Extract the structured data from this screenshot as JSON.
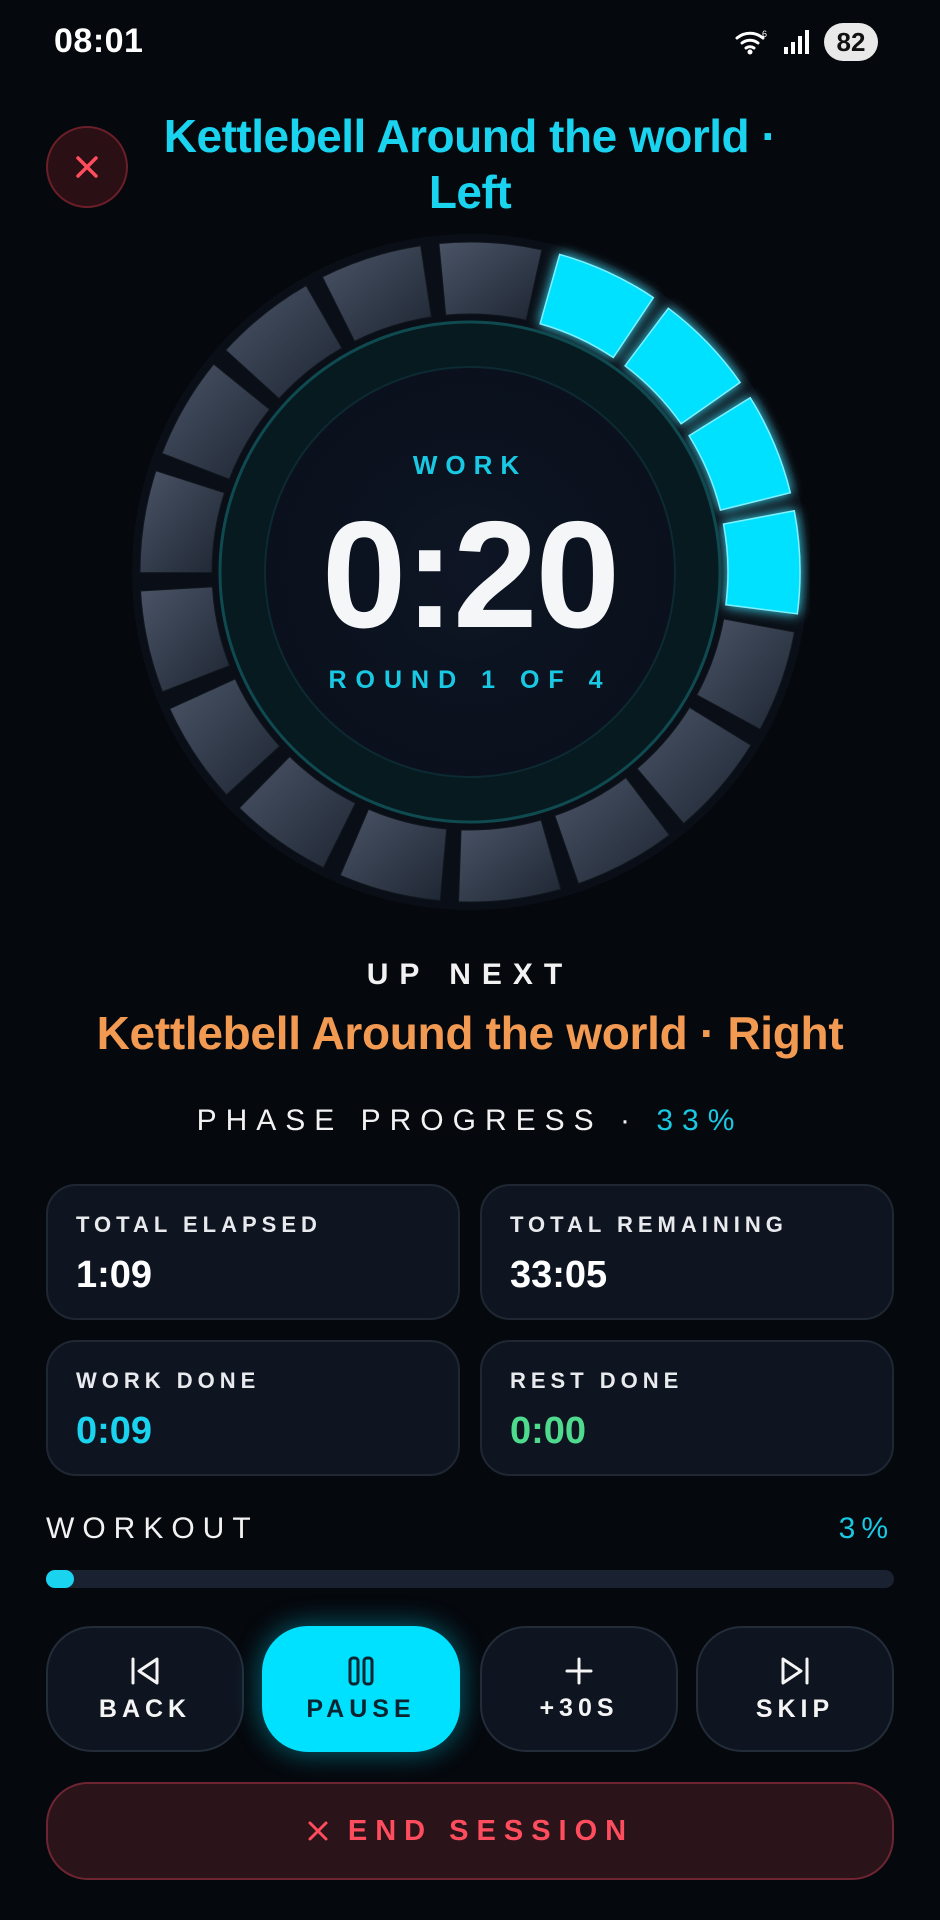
{
  "status_bar": {
    "time": "08:01",
    "battery": "82"
  },
  "header": {
    "title": "Kettlebell Around the world · Left"
  },
  "timer": {
    "phase": "WORK",
    "time": "0:20",
    "round_text": "ROUND 1 OF 4",
    "segments_total": 17,
    "segments_done": 4,
    "accent_color": "#00e1ff"
  },
  "up_next": {
    "label": "UP NEXT",
    "name": "Kettlebell Around the world · Right",
    "color": "#f29a52"
  },
  "phase_progress": {
    "label": "PHASE PROGRESS",
    "separator": "·",
    "percent_text": "33%"
  },
  "stats": {
    "total_elapsed": {
      "label": "TOTAL ELAPSED",
      "value": "1:09"
    },
    "total_remaining": {
      "label": "TOTAL REMAINING",
      "value": "33:05"
    },
    "work_done": {
      "label": "WORK DONE",
      "value": "0:09"
    },
    "rest_done": {
      "label": "REST DONE",
      "value": "0:00"
    }
  },
  "workout": {
    "label": "WORKOUT",
    "percent_text": "3%",
    "progress_fraction": 0.03
  },
  "controls": {
    "back": {
      "label": "BACK",
      "icon": "skip-back-icon"
    },
    "pause": {
      "label": "PAUSE",
      "icon": "pause-icon"
    },
    "add_time": {
      "label": "+30S",
      "icon": "plus-icon"
    },
    "skip": {
      "label": "SKIP",
      "icon": "skip-forward-icon"
    }
  },
  "end_session": {
    "label": "END SESSION",
    "icon": "close-icon"
  }
}
